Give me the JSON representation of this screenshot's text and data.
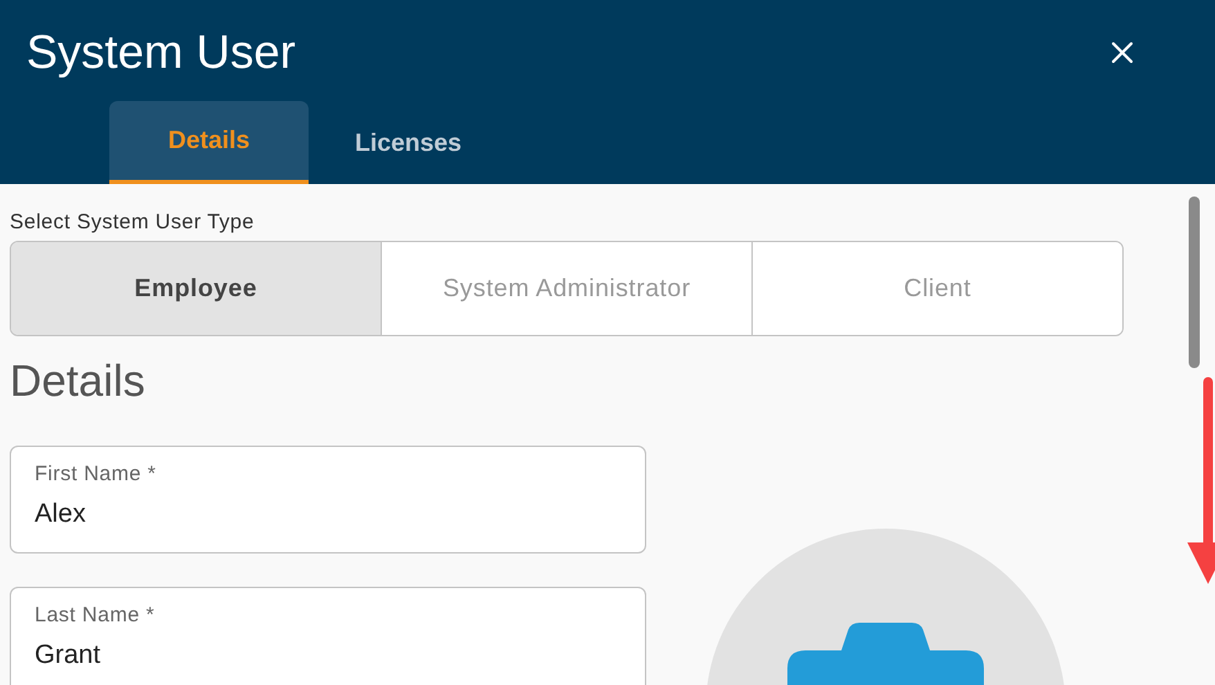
{
  "window": {
    "title": "System User"
  },
  "tabs": [
    {
      "label": "Details",
      "selected": true
    },
    {
      "label": "Licenses",
      "selected": false
    }
  ],
  "user_type": {
    "label": "Select System User Type",
    "options": [
      {
        "label": "Employee",
        "selected": true
      },
      {
        "label": "System Administrator",
        "selected": false
      },
      {
        "label": "Client",
        "selected": false
      }
    ]
  },
  "section_title": "Details",
  "fields": [
    {
      "label": "First Name *",
      "value": "Alex"
    },
    {
      "label": "Last Name *",
      "value": "Grant"
    }
  ]
}
